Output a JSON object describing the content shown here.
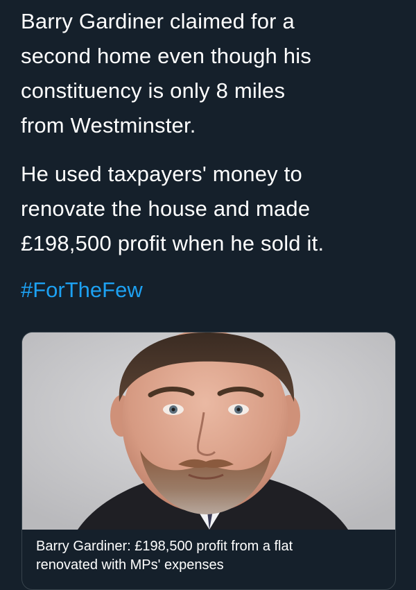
{
  "tweet": {
    "paragraph_1_lines": [
      "Barry Gardiner claimed for a",
      "second home even though his",
      "constituency is only 8 miles",
      "from Westminster."
    ],
    "paragraph_2_lines": [
      "He used taxpayers' money to",
      "renovate the house and made",
      "£198,500 profit when he sold it."
    ],
    "hashtag": "#ForTheFew"
  },
  "card": {
    "image_icon": "portrait-photo",
    "caption_lines": [
      "Barry Gardiner: £198,500 profit from a flat",
      "renovated with MPs' expenses"
    ]
  },
  "colors": {
    "background": "#15202b",
    "text": "#ffffff",
    "link": "#1da1f2",
    "card_border": "#38444d"
  }
}
